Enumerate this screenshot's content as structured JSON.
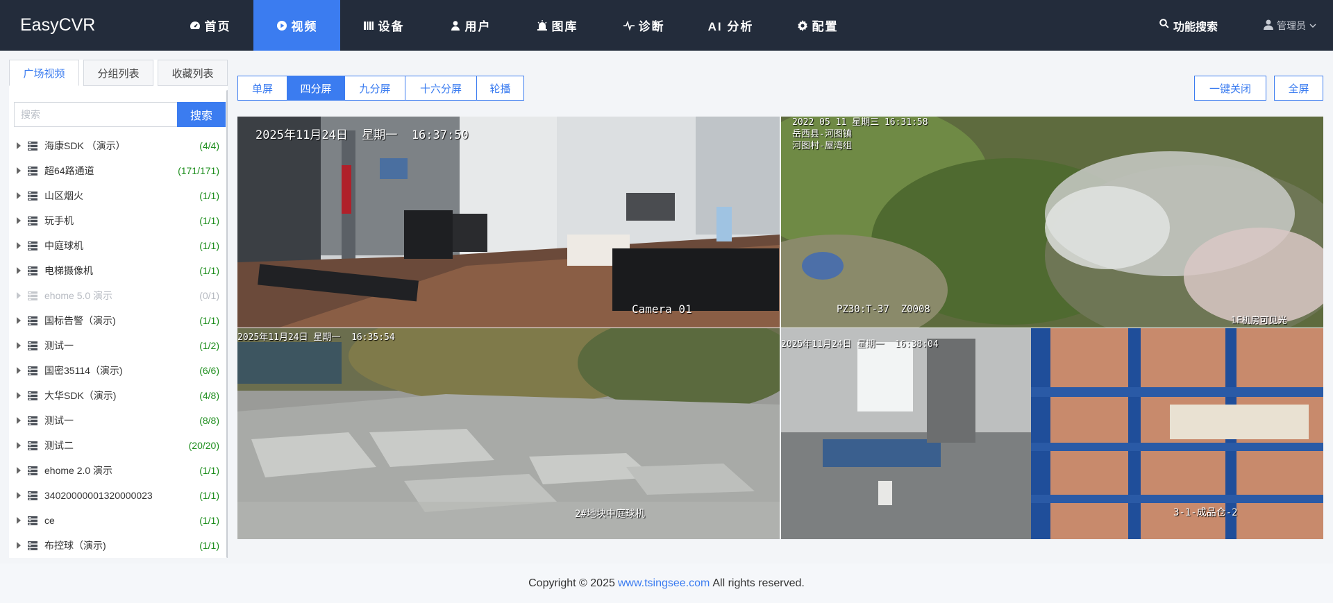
{
  "app": {
    "logo": "EasyCVR"
  },
  "nav": {
    "items": [
      {
        "label": "首页",
        "icon": "dashboard-icon"
      },
      {
        "label": "视频",
        "icon": "play-circle-icon"
      },
      {
        "label": "设备",
        "icon": "bars-icon"
      },
      {
        "label": "用户",
        "icon": "user-icon"
      },
      {
        "label": "图库",
        "icon": "gallery-icon"
      },
      {
        "label": "诊断",
        "icon": "pulse-icon"
      },
      {
        "label": "AI 分析",
        "icon": ""
      },
      {
        "label": "配置",
        "icon": "gear-icon"
      }
    ],
    "active": "视频",
    "func_search": "功能搜索",
    "user_label": "管理员"
  },
  "sidebar": {
    "tabs": [
      "广场视频",
      "分组列表",
      "收藏列表"
    ],
    "search_placeholder": "搜索",
    "search_button": "搜索",
    "tree": [
      {
        "label": "海康SDK （演示）",
        "count": "(4/4)",
        "online": true
      },
      {
        "label": "超64路通道",
        "count": "(171/171)",
        "online": true
      },
      {
        "label": "山区烟火",
        "count": "(1/1)",
        "online": true
      },
      {
        "label": "玩手机",
        "count": "(1/1)",
        "online": true
      },
      {
        "label": "中庭球机",
        "count": "(1/1)",
        "online": true
      },
      {
        "label": "电梯摄像机",
        "count": "(1/1)",
        "online": true
      },
      {
        "label": "ehome 5.0 演示",
        "count": "(0/1)",
        "online": false
      },
      {
        "label": "国标告警（演示)",
        "count": "(1/1)",
        "online": true
      },
      {
        "label": "测试一",
        "count": "(1/2)",
        "online": true
      },
      {
        "label": "国密35114（演示)",
        "count": "(6/6)",
        "online": true
      },
      {
        "label": "大华SDK（演示)",
        "count": "(4/8)",
        "online": true
      },
      {
        "label": "测试一",
        "count": "(8/8)",
        "online": true
      },
      {
        "label": "测试二",
        "count": "(20/20)",
        "online": true
      },
      {
        "label": "ehome 2.0 演示",
        "count": "(1/1)",
        "online": true
      },
      {
        "label": "34020000001320000023",
        "count": "(1/1)",
        "online": true
      },
      {
        "label": "ce",
        "count": "(1/1)",
        "online": true
      },
      {
        "label": "布控球（演示)",
        "count": "(1/1)",
        "online": true
      }
    ]
  },
  "toolbar": {
    "layouts": [
      "单屏",
      "四分屏",
      "九分屏",
      "十六分屏",
      "轮播"
    ],
    "active_layout": "四分屏",
    "close_all": "一键关闭",
    "fullscreen": "全屏"
  },
  "videos": [
    {
      "scene": "meeting-room",
      "osd_top": "2025年11月24日  星期一  16:37:50",
      "osd_bottom": "Camera 01"
    },
    {
      "scene": "mountain-smoke",
      "osd_top": "2022 05 11 星期三 16:31:58\n岳西县-河图镇\n河图村-屋湾组",
      "osd_bottom_left": "PZ30:T-37  Z0008",
      "osd_bottom": "1F机房可见光"
    },
    {
      "scene": "courtyard",
      "osd_top": "2025年11月24日 星期一  16:35:54",
      "osd_bottom": "2#地块中庭球机"
    },
    {
      "scene": "warehouse",
      "osd_top": "2025年11月24日 星期一  16:38:04",
      "osd_bottom": "3-1-成品仓-2"
    }
  ],
  "footer": {
    "prefix": "Copyright © 2025",
    "link": "www.tsingsee.com",
    "suffix": "All rights reserved."
  },
  "colors": {
    "nav_bg": "#232c3b",
    "accent": "#3b7cf0",
    "online_count": "#1e8e1e",
    "selected_border": "#1fb5e0"
  }
}
